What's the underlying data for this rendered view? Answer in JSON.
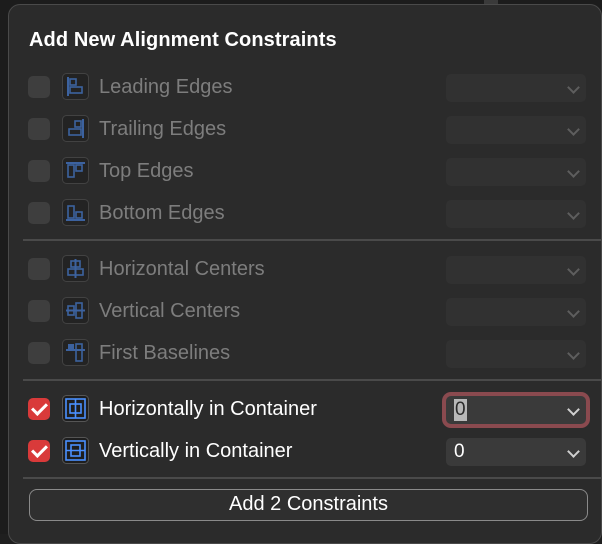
{
  "panel": {
    "title": "Add New Alignment Constraints",
    "add_button_label": "Add 2 Constraints"
  },
  "edges": [
    {
      "label": "Leading Edges",
      "icon": "leading-edges-icon",
      "checked": false,
      "enabled": false,
      "value": ""
    },
    {
      "label": "Trailing Edges",
      "icon": "trailing-edges-icon",
      "checked": false,
      "enabled": false,
      "value": ""
    },
    {
      "label": "Top Edges",
      "icon": "top-edges-icon",
      "checked": false,
      "enabled": false,
      "value": ""
    },
    {
      "label": "Bottom Edges",
      "icon": "bottom-edges-icon",
      "checked": false,
      "enabled": false,
      "value": ""
    }
  ],
  "centers": [
    {
      "label": "Horizontal Centers",
      "icon": "horizontal-centers-icon",
      "checked": false,
      "enabled": false,
      "value": ""
    },
    {
      "label": "Vertical Centers",
      "icon": "vertical-centers-icon",
      "checked": false,
      "enabled": false,
      "value": ""
    },
    {
      "label": "First Baselines",
      "icon": "first-baselines-icon",
      "checked": false,
      "enabled": false,
      "value": ""
    }
  ],
  "container": [
    {
      "label": "Horizontally in Container",
      "icon": "horizontally-in-container-icon",
      "checked": true,
      "enabled": true,
      "value": "0",
      "focused": true
    },
    {
      "label": "Vertically in Container",
      "icon": "vertically-in-container-icon",
      "checked": true,
      "enabled": true,
      "value": "0",
      "focused": false
    }
  ],
  "colors": {
    "accent_check": "#d93a3a",
    "icon_blue": "#4a90ff",
    "focus_ring": "#8a4a4f"
  }
}
